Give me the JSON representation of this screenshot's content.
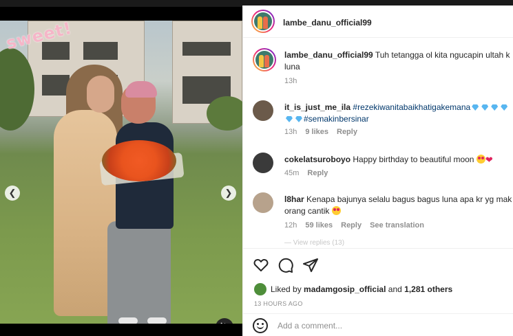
{
  "post": {
    "author": "lambe_danu_official99",
    "caption": "Tuh tetangga ol kita ngucapin ultah k luna",
    "caption_line1": "Tuh tetangga ol kita ngucapin ultah k",
    "caption_line2": "luna",
    "caption_age": "13h",
    "sticker_text": "sweet!",
    "carousel": {
      "total": 10,
      "active": 8
    }
  },
  "comments": [
    {
      "username": "it_is_just_me_ila",
      "line1_tag": "#rezekiwanitabaikhatigakemana",
      "line2_tag": "#semakinbersinar",
      "age": "13h",
      "likes": "9 likes",
      "reply": "Reply"
    },
    {
      "username": "cokelatsuroboyo",
      "text": "Happy birthday to beautiful moon",
      "age": "45m",
      "reply": "Reply"
    },
    {
      "username": "l8har",
      "line1": "Kenapa bajunya selalu bagus bagus luna apa kr yg mak",
      "line2": "orang cantik",
      "age": "12h",
      "likes": "59 likes",
      "reply": "Reply",
      "translate": "See translation"
    }
  ],
  "more_replies": "— View replies (13)",
  "liked_by": {
    "prefix": "Liked by",
    "user": "madamgosip_official",
    "and": "and",
    "others": "1,281 others"
  },
  "timestamp": "13 HOURS AGO",
  "add_comment": {
    "placeholder": "Add a comment..."
  },
  "icons": {
    "like": "heart-icon",
    "comment": "comment-icon",
    "share": "paper-plane-icon",
    "prev": "chevron-left-icon",
    "next": "chevron-right-icon",
    "mute": "speaker-mute-icon",
    "emoji": "smiley-icon"
  },
  "colors": {
    "link": "#00376b",
    "muted": "#8e8e8e",
    "active_dot": "#4aa3ff"
  }
}
